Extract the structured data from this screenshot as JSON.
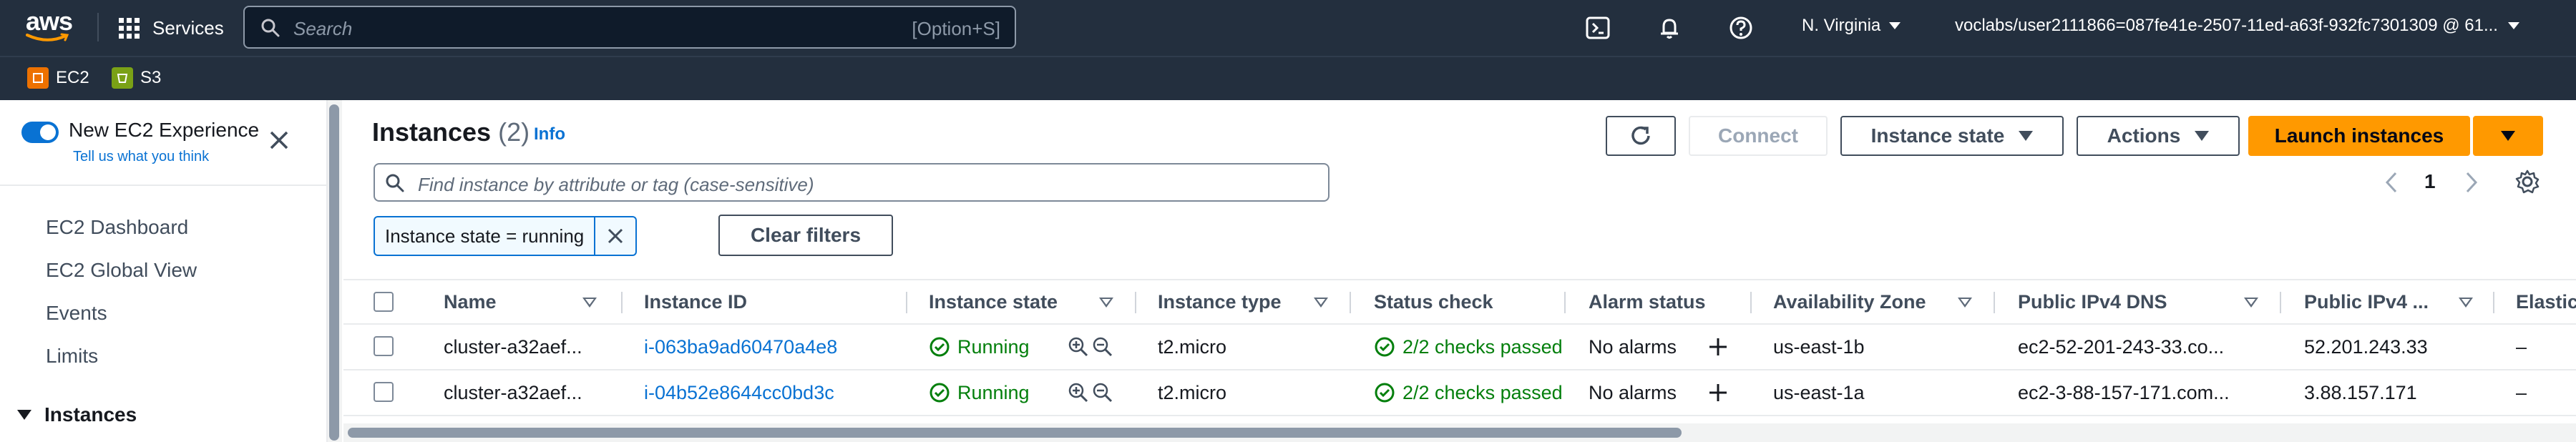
{
  "topnav": {
    "logo_text": "aws",
    "services_label": "Services",
    "search_placeholder": "Search",
    "search_shortcut": "[Option+S]",
    "region": "N. Virginia",
    "account": "voclabs/user2111866=087fe41e-2507-11ed-a63f-932fc7301309 @ 61..."
  },
  "favorites": [
    {
      "label": "EC2",
      "color": "#ed7100",
      "icon": "ec2-service-icon"
    },
    {
      "label": "S3",
      "color": "#7aa116",
      "icon": "s3-service-icon"
    }
  ],
  "sidebar": {
    "toggle_label": "New EC2 Experience",
    "toggle_on": true,
    "feedback_link": "Tell us what you think",
    "links": [
      "EC2 Dashboard",
      "EC2 Global View",
      "Events",
      "Limits"
    ],
    "section": "Instances"
  },
  "main": {
    "title": "Instances",
    "count": "(2)",
    "info": "Info",
    "buttons": {
      "connect": "Connect",
      "instance_state": "Instance state",
      "actions": "Actions",
      "launch": "Launch instances"
    },
    "finder_placeholder": "Find instance by attribute or tag (case-sensitive)",
    "page": "1",
    "filter_token": "Instance state = running",
    "clear_filters": "Clear filters"
  },
  "table": {
    "columns": [
      "Name",
      "Instance ID",
      "Instance state",
      "Instance type",
      "Status check",
      "Alarm status",
      "Availability Zone",
      "Public IPv4 DNS",
      "Public IPv4 ...",
      "Elastic"
    ],
    "rows": [
      {
        "name": "cluster-a32aef...",
        "id": "i-063ba9ad60470a4e8",
        "state": "Running",
        "type": "t2.micro",
        "status": "2/2 checks passed",
        "alarm": "No alarms",
        "az": "us-east-1b",
        "dns": "ec2-52-201-243-33.co...",
        "ip": "52.201.243.33",
        "elastic": "–"
      },
      {
        "name": "cluster-a32aef...",
        "id": "i-04b52e8644cc0bd3c",
        "state": "Running",
        "type": "t2.micro",
        "status": "2/2 checks passed",
        "alarm": "No alarms",
        "az": "us-east-1a",
        "dns": "ec2-3-88-157-171.com...",
        "ip": "3.88.157.171",
        "elastic": "–"
      }
    ]
  },
  "colors": {
    "nav_bg": "#232f3e",
    "link": "#0972d3",
    "primary": "#ff9900",
    "success": "#037f0c"
  }
}
